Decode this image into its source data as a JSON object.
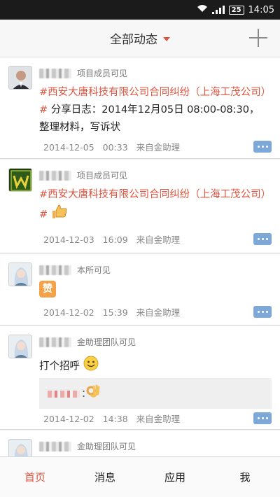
{
  "status_bar": {
    "time": "14:05",
    "battery": "25"
  },
  "header": {
    "title": "全部动态"
  },
  "posts": [
    {
      "visibility": "项目成员可见",
      "topic": "#西安大唐科技有限公司合同纠纷（上海工茂公司）#",
      "text": "分享日志：2014年12月05日 08:00-08:30，整理材料，写诉状",
      "date": "2014-12-05",
      "time": "00:33",
      "source": "来自金助理"
    },
    {
      "visibility": "项目成员可见",
      "topic": "#西安大唐科技有限公司合同纠纷（上海工茂公司）#",
      "text": "",
      "date": "2014-12-03",
      "time": "16:09",
      "source": "来自金助理"
    },
    {
      "visibility": "本所可见",
      "text": "赞",
      "date": "2014-12-02",
      "time": "15:39",
      "source": "来自金助理"
    },
    {
      "visibility": "金助理团队可见",
      "text": "打个招呼",
      "reply_separator": "：",
      "date": "2014-12-02",
      "time": "14:38",
      "source": "来自金助理"
    },
    {
      "visibility": "金助理团队可见"
    }
  ],
  "tabs": [
    {
      "label": "首页",
      "active": true
    },
    {
      "label": "消息"
    },
    {
      "label": "应用"
    },
    {
      "label": "我"
    }
  ],
  "colors": {
    "accent": "#e0543f",
    "more_button": "#7da8d8",
    "status_bar": "#1b1b1b"
  }
}
